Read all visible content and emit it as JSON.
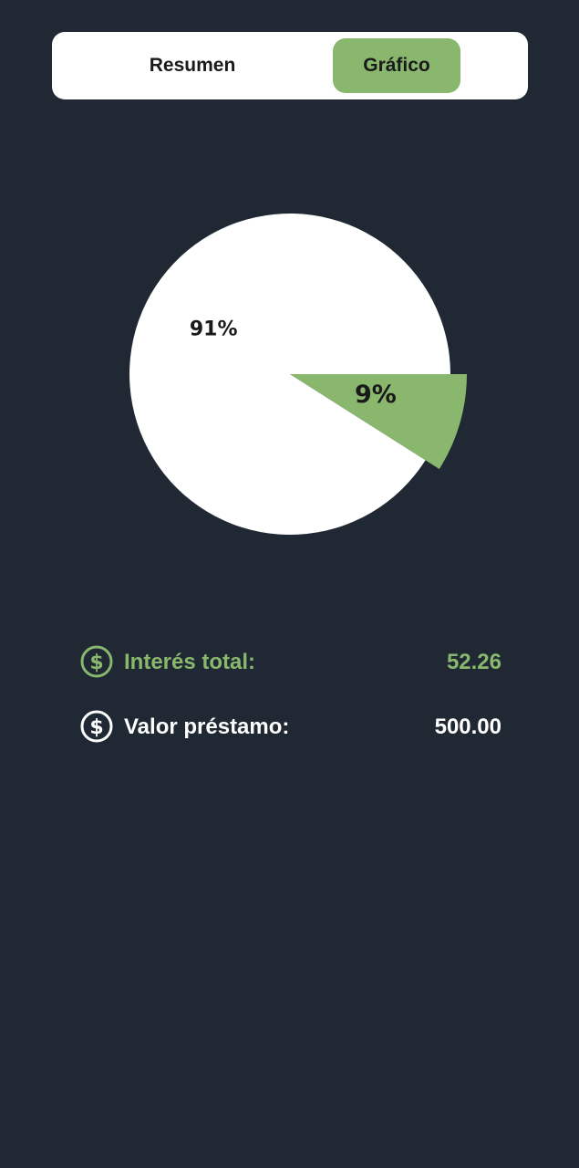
{
  "tabs": {
    "items": [
      {
        "label": "Resumen",
        "active": false
      },
      {
        "label": "Gráfico",
        "active": true
      }
    ]
  },
  "chart_data": {
    "type": "pie",
    "slices": [
      {
        "label": "91%",
        "value": 91,
        "color": "#ffffff"
      },
      {
        "label": "9%",
        "value": 9,
        "color": "#88b76d"
      }
    ]
  },
  "summary": {
    "interes": {
      "label": "Interés total:",
      "value": "52.26",
      "icon": "dollar-coin-icon",
      "color": "#88b76d"
    },
    "valor": {
      "label": "Valor préstamo:",
      "value": "500.00",
      "icon": "dollar-coin-icon",
      "color": "#ffffff"
    }
  },
  "colors": {
    "background": "#1f2833",
    "accent": "#88b76d",
    "card": "#ffffff"
  }
}
